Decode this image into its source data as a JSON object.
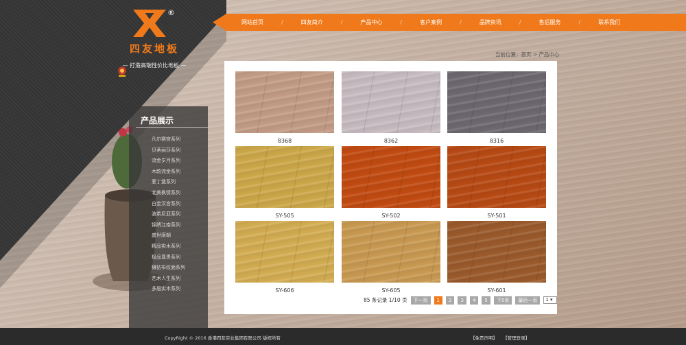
{
  "logo": {
    "name": "四友地板",
    "slogan": "— 打造高端性价比地板 —",
    "reg": "®"
  },
  "nav": [
    "网站首页",
    "四友简介",
    "产品中心",
    "客户案例",
    "品牌资讯",
    "售后服务",
    "联系我们"
  ],
  "sidebar": {
    "title": "产品展示",
    "items": [
      "凡尔赛宫系列",
      "贝蒂丽莎系列",
      "流金岁月系列",
      "木韵流金系列",
      "爱丁堡系列",
      "北美枫情系列",
      "白金汉宫系列",
      "波希尼亚系列",
      "锦绣江南系列",
      "盛世唐朝",
      "精品实木系列",
      "极品尊贵系列",
      "镶钻布纹面系列",
      "艺术人生系列",
      "多层实木系列"
    ]
  },
  "breadcrumb": "当前位置：首页 > 产品中心",
  "products": [
    {
      "name": "8368",
      "color": "#c39c86"
    },
    {
      "name": "8362",
      "color": "#c7bcc1"
    },
    {
      "name": "8316",
      "color": "#6e6870"
    },
    {
      "name": "SY-505",
      "color": "#cda84a"
    },
    {
      "name": "SY-502",
      "color": "#c24b12"
    },
    {
      "name": "SY-501",
      "color": "#b84a14"
    },
    {
      "name": "SY-606",
      "color": "#d3ad52"
    },
    {
      "name": "SY-605",
      "color": "#c99a52"
    },
    {
      "name": "SY-601",
      "color": "#9b5b2c"
    }
  ],
  "pager": {
    "info": "85 条记录 1/10 页",
    "prev": "下一页",
    "pages": [
      "1",
      "2",
      "3",
      "4",
      "5"
    ],
    "next5": "下5页",
    "last": "最后一页",
    "select": "1"
  },
  "footer": {
    "copyright": "CopyRight © 2016 香港四友实业集团有限公司 版权所有",
    "disclaimer": "【免责声明】",
    "admin": "【管理登录】"
  },
  "colors": {
    "accent": "#f07a1b",
    "dark": "#333333"
  }
}
